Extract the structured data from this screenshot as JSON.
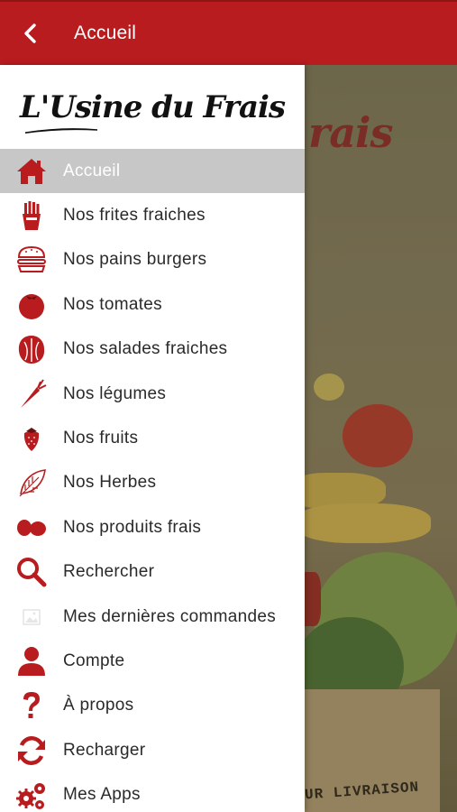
{
  "header": {
    "title": "Accueil",
    "back_icon": "chevron-left-icon",
    "background": "#b81c1f"
  },
  "brand": {
    "logo_text": "L'Usine du Frais"
  },
  "hero": {
    "logo_fragment": "rais",
    "bag_text": "UR LIVRAISON"
  },
  "accent_color": "#b81c1f",
  "menu": {
    "items": [
      {
        "label": "Accueil",
        "icon": "home-icon",
        "active": true
      },
      {
        "label": "Nos frites fraiches",
        "icon": "fries-icon"
      },
      {
        "label": "Nos pains burgers",
        "icon": "burger-icon"
      },
      {
        "label": "Nos tomates",
        "icon": "tomato-icon"
      },
      {
        "label": "Nos salades fraiches",
        "icon": "salad-icon"
      },
      {
        "label": "Nos légumes",
        "icon": "carrot-icon"
      },
      {
        "label": "Nos fruits",
        "icon": "strawberry-icon"
      },
      {
        "label": "Nos Herbes",
        "icon": "leaf-icon"
      },
      {
        "label": "Nos produits frais",
        "icon": "beans-icon"
      },
      {
        "label": "Rechercher",
        "icon": "search-icon"
      },
      {
        "label": "Mes dernières commandes",
        "icon": "image-placeholder-icon"
      },
      {
        "label": "Compte",
        "icon": "user-icon"
      },
      {
        "label": "À propos",
        "icon": "question-icon"
      },
      {
        "label": "Recharger",
        "icon": "refresh-icon"
      },
      {
        "label": "Mes Apps",
        "icon": "gears-icon"
      }
    ]
  }
}
